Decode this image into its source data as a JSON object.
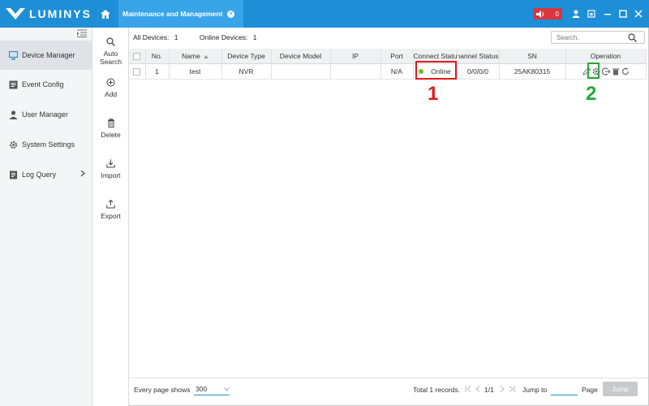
{
  "app": {
    "logo_text": "LUMINYS",
    "tab_title": "Maintenance and Management",
    "alarm_count": "0"
  },
  "colors": {
    "titlebar": "#1e8fd6",
    "online": "#6cbf2a",
    "highlight_red": "#e01b1b",
    "highlight_green": "#25a83a"
  },
  "nav": {
    "items": [
      {
        "label": "Device Manager",
        "icon": "device-manager-icon",
        "active": true
      },
      {
        "label": "Event Config",
        "icon": "event-config-icon"
      },
      {
        "label": "User Manager",
        "icon": "user-icon"
      },
      {
        "label": "System Settings",
        "icon": "gear-icon"
      },
      {
        "label": "Log Query",
        "icon": "log-icon",
        "has_submenu": true
      }
    ]
  },
  "tools": [
    {
      "label": "Auto Search",
      "icon": "search-icon"
    },
    {
      "label": "Add",
      "icon": "plus-circle-icon"
    },
    {
      "label": "Delete",
      "icon": "trash-icon"
    },
    {
      "label": "Import",
      "icon": "import-icon"
    },
    {
      "label": "Export",
      "icon": "export-icon"
    }
  ],
  "counts": {
    "all_label": "All Devices:",
    "all_value": "1",
    "online_label": "Online Devices:",
    "online_value": "1"
  },
  "search": {
    "placeholder": "Search."
  },
  "table": {
    "headers": [
      "No.",
      "Name",
      "Device Type",
      "Device Model",
      "IP",
      "Port",
      "Connect Status",
      "Channel Status",
      "SN",
      "Operation"
    ],
    "rows": [
      {
        "no": "1",
        "name": "test",
        "type": "NVR",
        "model": "",
        "ip": "",
        "port": "N/A",
        "status": "Online",
        "channel": "0/0/0/0",
        "sn": "25AK80315"
      }
    ]
  },
  "annotations": {
    "callout_1": "1",
    "callout_2": "2"
  },
  "footer": {
    "page_size_label": "Every page shows",
    "page_size_value": "300",
    "records": "Total 1 records.",
    "page_indicator": "1/1",
    "jump_label": "Jump to",
    "page_label": "Page",
    "jump_button": "Jump"
  }
}
